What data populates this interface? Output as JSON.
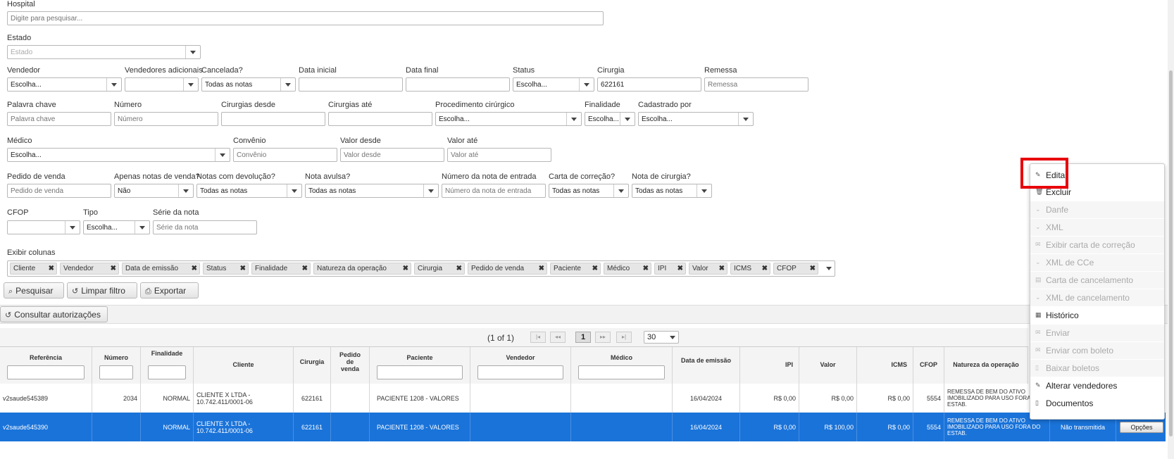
{
  "filters": {
    "hospital": {
      "label": "Hospital",
      "placeholder": "Digite para pesquisar..."
    },
    "estado": {
      "label": "Estado",
      "placeholder": "Estado"
    },
    "vendedor": {
      "label": "Vendedor",
      "value": "Escolha..."
    },
    "vendedores_adicionais": {
      "label": "Vendedores adicionais",
      "value": ""
    },
    "cancelada": {
      "label": "Cancelada?",
      "value": "Todas as notas"
    },
    "data_inicial": {
      "label": "Data inicial",
      "value": ""
    },
    "data_final": {
      "label": "Data final",
      "value": ""
    },
    "status": {
      "label": "Status",
      "value": "Escolha..."
    },
    "cirurgia": {
      "label": "Cirurgia",
      "value": "622161"
    },
    "remessa": {
      "label": "Remessa",
      "placeholder": "Remessa"
    },
    "palavra_chave": {
      "label": "Palavra chave",
      "placeholder": "Palavra chave"
    },
    "numero": {
      "label": "Número",
      "placeholder": "Número"
    },
    "cirurgias_desde": {
      "label": "Cirurgias desde",
      "value": ""
    },
    "cirurgias_ate": {
      "label": "Cirurgias até",
      "value": ""
    },
    "procedimento": {
      "label": "Procedimento cirúrgico",
      "value": "Escolha..."
    },
    "finalidade": {
      "label": "Finalidade",
      "value": "Escolha..."
    },
    "cadastrado_por": {
      "label": "Cadastrado por",
      "value": "Escolha..."
    },
    "medico": {
      "label": "Médico",
      "value": "Escolha..."
    },
    "convenio": {
      "label": "Convênio",
      "placeholder": "Convênio"
    },
    "valor_desde": {
      "label": "Valor desde",
      "placeholder": "Valor desde"
    },
    "valor_ate": {
      "label": "Valor até",
      "placeholder": "Valor até"
    },
    "pedido_venda": {
      "label": "Pedido de venda",
      "placeholder": "Pedido de venda"
    },
    "apenas_notas_venda": {
      "label": "Apenas notas de venda?",
      "value": "Não"
    },
    "notas_devolucao": {
      "label": "Notas com devolução?",
      "value": "Todas as notas"
    },
    "nota_avulsa": {
      "label": "Nota avulsa?",
      "value": "Todas as notas"
    },
    "numero_nota_entrada": {
      "label": "Número da nota de entrada",
      "placeholder": "Número da nota de entrada"
    },
    "carta_correcao": {
      "label": "Carta de correção?",
      "value": "Todas as notas"
    },
    "nota_cirurgia": {
      "label": "Nota de cirurgia?",
      "value": "Todas as notas"
    },
    "cfop": {
      "label": "CFOP",
      "value": ""
    },
    "tipo": {
      "label": "Tipo",
      "value": "Escolha..."
    },
    "serie_nota": {
      "label": "Série da nota",
      "placeholder": "Série da nota"
    }
  },
  "columns": {
    "label": "Exibir colunas",
    "tags": [
      "Cliente",
      "Vendedor",
      "Data de emissão",
      "Status",
      "Finalidade",
      "Natureza da operação",
      "Cirurgia",
      "Pedido de venda",
      "Paciente",
      "Médico",
      "IPI",
      "Valor",
      "ICMS",
      "CFOP"
    ]
  },
  "buttons": {
    "pesquisar": "Pesquisar",
    "limpar": "Limpar filtro",
    "exportar": "Exportar",
    "consultar": "Consultar autorizações"
  },
  "pager": {
    "info": "(1 of 1)",
    "page": "1",
    "rows_per_page": "30"
  },
  "table": {
    "headers": [
      "Referência",
      "Número",
      "Finalidade",
      "Cliente",
      "Cirurgia",
      "Pedido de venda",
      "Paciente",
      "Vendedor",
      "Médico",
      "Data de emissão",
      "IPI",
      "Valor",
      "ICMS",
      "CFOP",
      "Natureza da operação"
    ],
    "rows": [
      {
        "referencia": "v2saude545389",
        "numero": "2034",
        "finalidade": "NORMAL",
        "cliente": "CLIENTE X LTDA - 10.742.411/0001-06",
        "cirurgia": "622161",
        "pedido": "",
        "paciente": "PACIENTE 1208 - VALORES",
        "vendedor": "",
        "medico": "",
        "data": "16/04/2024",
        "ipi": "R$ 0,00",
        "valor": "R$ 0,00",
        "icms": "R$ 0,00",
        "cfop": "5554",
        "natureza": "REMESSA DE BEM DO ATIVO IMOBILIZADO PARA USO FORA DO ESTAB.",
        "status": "",
        "opcoes": ""
      },
      {
        "referencia": "v2saude545390",
        "numero": "",
        "finalidade": "NORMAL",
        "cliente": "CLIENTE X LTDA - 10.742.411/0001-06",
        "cirurgia": "622161",
        "pedido": "",
        "paciente": "PACIENTE 1208 - VALORES",
        "vendedor": "",
        "medico": "",
        "data": "16/04/2024",
        "ipi": "R$ 0,00",
        "valor": "R$ 100,00",
        "icms": "R$ 0,00",
        "cfop": "5554",
        "natureza": "REMESSA DE BEM DO ATIVO IMOBILIZADO PARA USO FORA DO ESTAB.",
        "status": "Não transmitida",
        "opcoes": "Opções"
      }
    ]
  },
  "menu": {
    "items": [
      {
        "label": "Editar",
        "icon": "pencil-icon",
        "enabled": true
      },
      {
        "label": "Excluir",
        "icon": "trash-icon",
        "enabled": true
      },
      {
        "label": "Danfe",
        "icon": "chevron-icon",
        "enabled": false
      },
      {
        "label": "XML",
        "icon": "chevron-icon",
        "enabled": false
      },
      {
        "label": "Exibir carta de correção",
        "icon": "envelope-icon",
        "enabled": false
      },
      {
        "label": "XML de CCe",
        "icon": "chevron-icon",
        "enabled": false
      },
      {
        "label": "Carta de cancelamento",
        "icon": "print-icon",
        "enabled": false
      },
      {
        "label": "XML de cancelamento",
        "icon": "chevron-icon",
        "enabled": false
      },
      {
        "label": "Histórico",
        "icon": "calendar-icon",
        "enabled": true
      },
      {
        "label": "Enviar",
        "icon": "envelope-icon",
        "enabled": false
      },
      {
        "label": "Enviar com boleto",
        "icon": "envelope-icon",
        "enabled": false
      },
      {
        "label": "Baixar boletos",
        "icon": "document-icon",
        "enabled": false
      },
      {
        "label": "Alterar vendedores",
        "icon": "pencil-icon",
        "enabled": true
      },
      {
        "label": "Documentos",
        "icon": "document-icon",
        "enabled": true
      }
    ]
  },
  "colors": {
    "selected_row": "#1a73d9",
    "highlight": "#e8000b"
  }
}
